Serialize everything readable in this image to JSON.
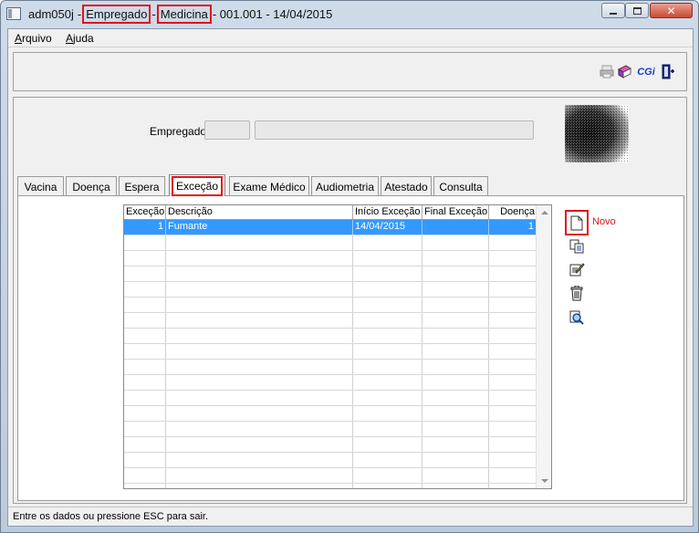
{
  "window": {
    "title_prefix": "adm050j",
    "title_dash1": "-",
    "title_part1": "Empregado",
    "title_dash2": "-",
    "title_part2": "Medicina",
    "title_suffix": "- 001.001 - 14/04/2015"
  },
  "menu": {
    "arquivo": "Arquivo",
    "ajuda": "Ajuda"
  },
  "toolbar": {
    "cgi_label": "CGi"
  },
  "form": {
    "empregado_label": "Empregado:",
    "empregado_code": "",
    "empregado_name": ""
  },
  "tabs": [
    "Vacina",
    "Doença",
    "Espera",
    "Exceção",
    "Exame Médico",
    "Audiometria",
    "Atestado",
    "Consulta"
  ],
  "active_tab": "Exceção",
  "grid": {
    "columns": [
      "Exceção",
      "Descrição",
      "Início Exceção",
      "Final Exceção",
      "Doença"
    ],
    "rows": [
      [
        "1",
        "Fumante",
        "14/04/2015",
        "",
        "1"
      ]
    ]
  },
  "actions": {
    "novo_label": "Novo"
  },
  "status": {
    "text": "Entre os dados ou pressione ESC para sair."
  },
  "colors": {
    "highlight": "#e0141a",
    "selection": "#3399ff",
    "cgi": "#1a3cc4"
  }
}
